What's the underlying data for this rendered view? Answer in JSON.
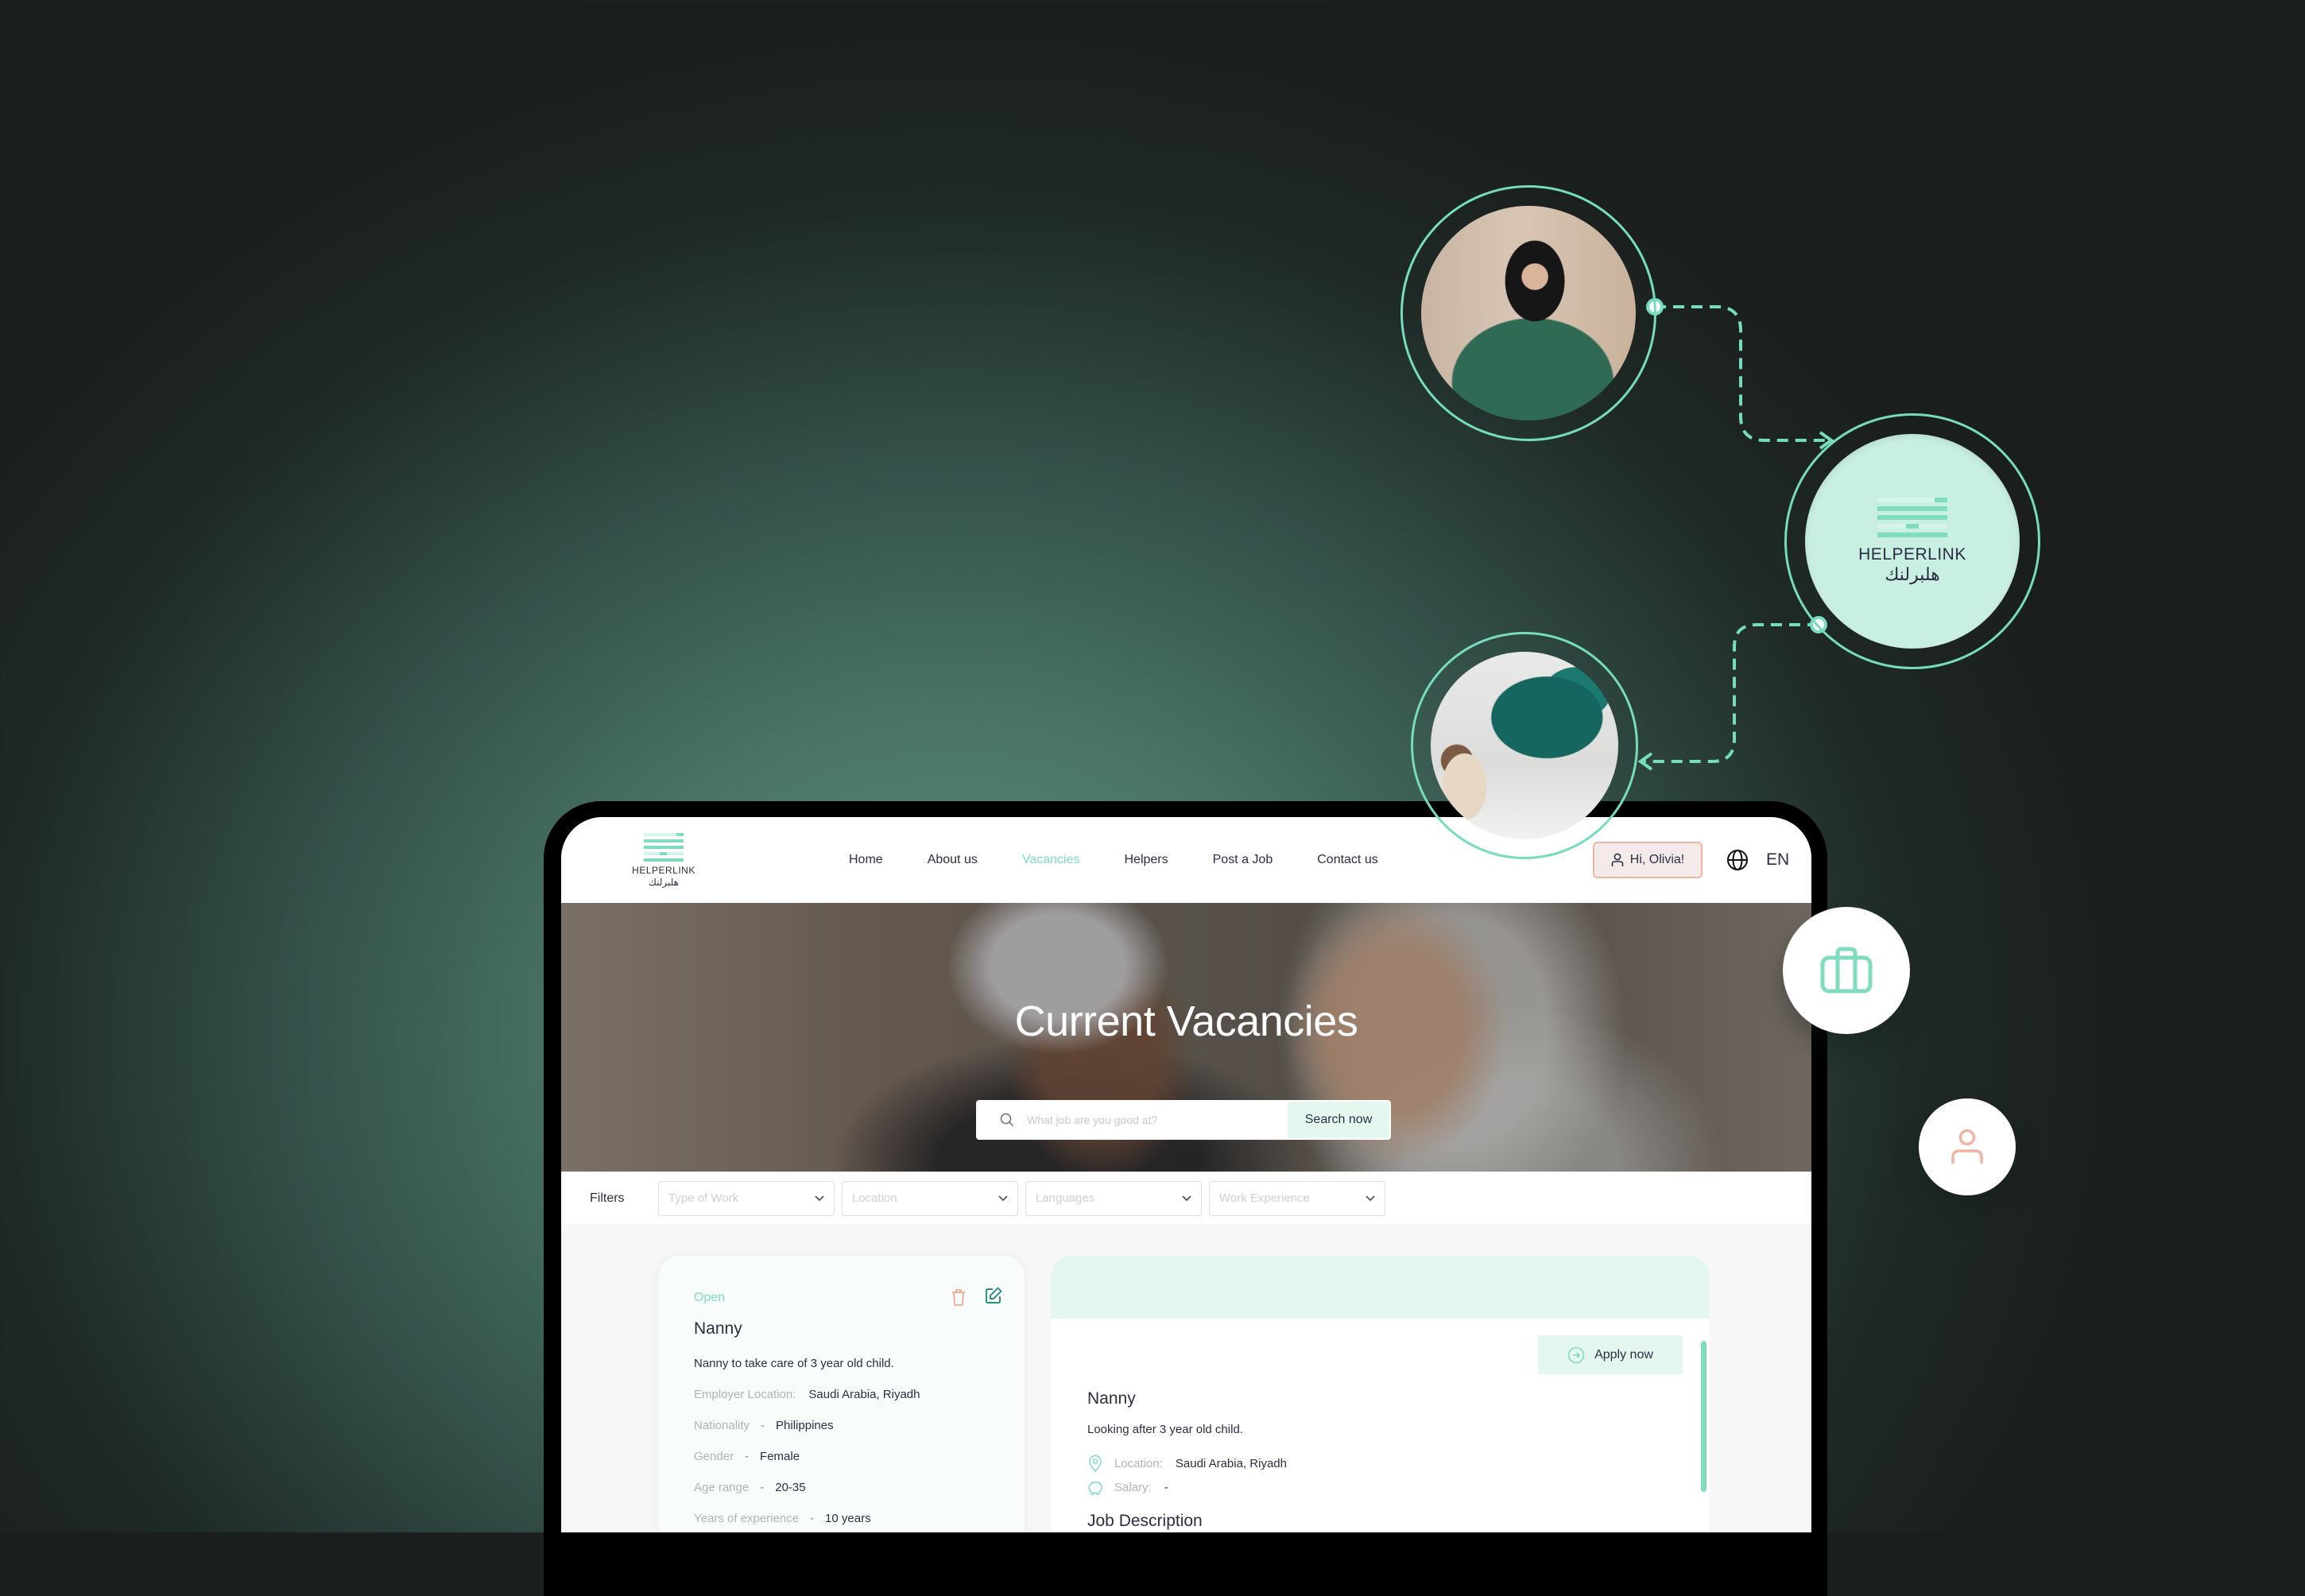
{
  "brand": {
    "name_en": "HELPERLINK",
    "name_ar": "هلبرلنك",
    "accent": "#7fdcbe",
    "accent_light": "#e4f7ef",
    "coral": "#f1b3a2",
    "text_dark": "#2b2d42"
  },
  "floating": {
    "top_photo": "woman-with-cup-photo",
    "bottom_photo": "woman-with-sheet-photo",
    "briefcase_icon": "briefcase-icon",
    "user_icon": "user-icon"
  },
  "header": {
    "nav": [
      {
        "label": "Home",
        "active": false
      },
      {
        "label": "About us",
        "active": false
      },
      {
        "label": "Vacancies",
        "active": true
      },
      {
        "label": "Helpers",
        "active": false
      },
      {
        "label": "Post a Job",
        "active": false
      },
      {
        "label": "Contact us",
        "active": false
      }
    ],
    "user_greeting": "Hi, Olivia!",
    "language": "EN"
  },
  "hero": {
    "title": "Current Vacancies",
    "search_placeholder": "What job are you good at?",
    "search_value": "",
    "search_button": "Search now"
  },
  "filters": {
    "label": "Filters",
    "selects": [
      {
        "placeholder": "Type of Work"
      },
      {
        "placeholder": "Location"
      },
      {
        "placeholder": "Languages"
      },
      {
        "placeholder": "Work Experience"
      }
    ]
  },
  "job_card": {
    "status": "Open",
    "title": "Nanny",
    "description": "Nanny to take care of 3 year old child.",
    "employer_location_label": "Employer Location:",
    "employer_location": "Saudi Arabia, Riyadh",
    "fields": [
      {
        "label": "Nationality",
        "sep": "-",
        "value": "Philippines"
      },
      {
        "label": "Gender",
        "sep": "-",
        "value": "Female"
      },
      {
        "label": "Age range",
        "sep": "-",
        "value": "20-35"
      },
      {
        "label": "Years of experience",
        "sep": "-",
        "value": "10 years"
      }
    ]
  },
  "job_detail": {
    "apply_button": "Apply now",
    "title": "Nanny",
    "description": "Looking after 3 year old child.",
    "location_label": "Location:",
    "location": "Saudi Arabia, Riyadh",
    "salary_label": "Salary:",
    "salary": "-",
    "section_heading": "Job Description"
  }
}
